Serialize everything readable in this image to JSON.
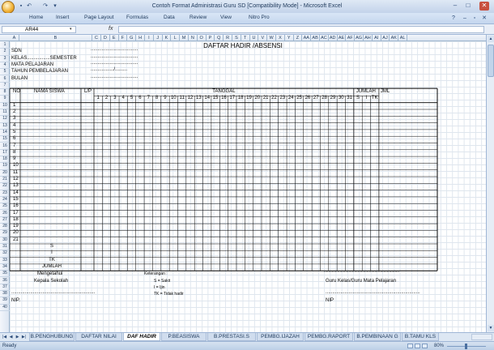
{
  "window": {
    "title": "Contoh Format Administrasi Guru SD  [Compatibility Mode] - Microsoft Excel",
    "minimize": "–",
    "maximize": "□",
    "close": "✕"
  },
  "quick_access": {
    "save": "▪",
    "undo": "↶",
    "redo": "↷",
    "more": "▾"
  },
  "ribbon": {
    "tabs": [
      "Home",
      "Insert",
      "Page Layout",
      "Formulas",
      "Data",
      "Review",
      "View",
      "Nitro Pro"
    ],
    "help": "?",
    "min": "–",
    "restore": "▫",
    "close": "✕"
  },
  "formula_bar": {
    "name_box": "AR44",
    "dropdown": "▾",
    "fx": "fx",
    "formula": ""
  },
  "columns": [
    "A",
    "B",
    "C",
    "D",
    "E",
    "F",
    "G",
    "H",
    "I",
    "J",
    "K",
    "L",
    "M",
    "N",
    "O",
    "P",
    "Q",
    "R",
    "S",
    "T",
    "U",
    "V",
    "W",
    "X",
    "Y",
    "Z",
    "AA",
    "AB",
    "AC",
    "AD",
    "AE",
    "AF",
    "AG",
    "AH",
    "AI",
    "AJ",
    "AK",
    "AL"
  ],
  "rows": [
    "1",
    "2",
    "3",
    "4",
    "5",
    "6",
    "7",
    "8",
    "9",
    "10",
    "11",
    "12",
    "13",
    "14",
    "15",
    "16",
    "17",
    "18",
    "19",
    "20",
    "21",
    "22",
    "23",
    "24",
    "25",
    "26",
    "27",
    "28",
    "29",
    "30",
    "31",
    "32",
    "33",
    "34",
    "35",
    "36",
    "37",
    "38",
    "39",
    "40"
  ],
  "doc": {
    "title": "DAFTAR HADIR /ABSENSI",
    "sdn": "SDN",
    "kelas": "KELAS.................SEMESTER",
    "mapel": "MATA PELAJARAN",
    "tahun": "TAHUN PEMBELAJARAN",
    "bulan": "BULAN",
    "dots1": "...................................",
    "dots2": "...................................",
    "dots3": "...................................",
    "dots4": "................./.........",
    "dots5": "...................................",
    "h_no": "NO",
    "h_nama": "NAMA  SISWA",
    "h_lp": "L/P",
    "h_tanggal": "TANGGAL",
    "h_jumlah": "JUMLAH",
    "h_jml": "JML",
    "sit": [
      "S",
      "I",
      "TK"
    ],
    "days": [
      "1",
      "2",
      "3",
      "4",
      "5",
      "6",
      "7",
      "8",
      "9",
      "10",
      "11",
      "12",
      "13",
      "14",
      "15",
      "16",
      "17",
      "18",
      "19",
      "20",
      "21",
      "22",
      "23",
      "24",
      "25",
      "26",
      "27",
      "28",
      "29",
      "30",
      "31"
    ],
    "nos": [
      "1",
      "2",
      "3",
      "4",
      "5",
      "6",
      "7",
      "8",
      "9",
      "10",
      "11",
      "12",
      "13",
      "14",
      "15",
      "16",
      "17",
      "18",
      "19",
      "20",
      "21"
    ],
    "sum_s": "S",
    "sum_i": "I",
    "sum_tk": "TK",
    "sum_jumlah": "JUMLAH",
    "mengetahui": "Mengetahui",
    "kepala": "Kepala Sekolah",
    "ket": "Keterangan :",
    "ket_s": "S    = Sakit",
    "ket_i": "I     = Ijin",
    "ket_tk": "TK = Tidak hadir",
    "guru": "Guru Kelas/Guru Mata Pelajaran",
    "nip_left": "NIP.",
    "nip_right": "NIP",
    "sign_line": "..............................................................",
    "sign_line2": "......................................................................",
    "dots_right": "..................................................................."
  },
  "sheet_tabs": [
    "B.PENGHUBUNG",
    "DAFTAR NILAI",
    "DAF HADIR",
    "P.BEASISWA",
    "B.PRESTASI.S",
    "PEMBG.IJAZAH",
    "PEMBG.RAPORT",
    "B.PEMBINAAN G",
    "B.TAMU KLS"
  ],
  "active_tab": "DAF HADIR",
  "status": {
    "ready": "Ready",
    "zoom": "80%"
  }
}
